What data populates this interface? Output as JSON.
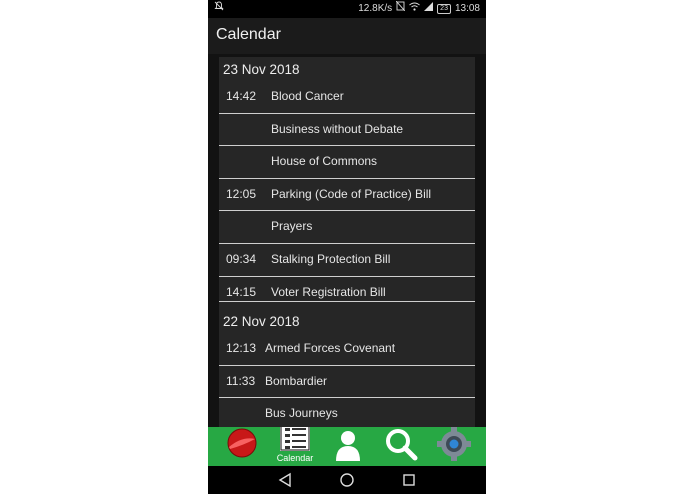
{
  "status_bar": {
    "speed": "12.8K/s",
    "battery": "23",
    "time": "13:08"
  },
  "app_bar": {
    "title": "Calendar"
  },
  "days": [
    {
      "date": "23 Nov 2018",
      "items": [
        {
          "time": "14:42",
          "title": "Blood Cancer"
        },
        {
          "time": "",
          "title": "Business without Debate"
        },
        {
          "time": "",
          "title": "House of Commons"
        },
        {
          "time": "12:05",
          "title": "Parking (Code of Practice) Bill"
        },
        {
          "time": "",
          "title": "Prayers"
        },
        {
          "time": "09:34",
          "title": "Stalking Protection Bill"
        },
        {
          "time": "14:15",
          "title": "Voter Registration Bill"
        }
      ]
    },
    {
      "date": "22 Nov 2018",
      "items": [
        {
          "time": "12:13",
          "title": "Armed Forces Covenant"
        },
        {
          "time": "11:33",
          "title": "Bombardier"
        },
        {
          "time": "",
          "title": "Bus Journeys"
        }
      ]
    }
  ],
  "bottom_nav": {
    "active_label": "Calendar",
    "items": [
      "ball-icon",
      "calendar-icon",
      "person-icon",
      "search-icon",
      "settings-icon"
    ]
  },
  "colors": {
    "nav_green": "#27a844",
    "card_bg": "#262626",
    "background": "#121212"
  }
}
